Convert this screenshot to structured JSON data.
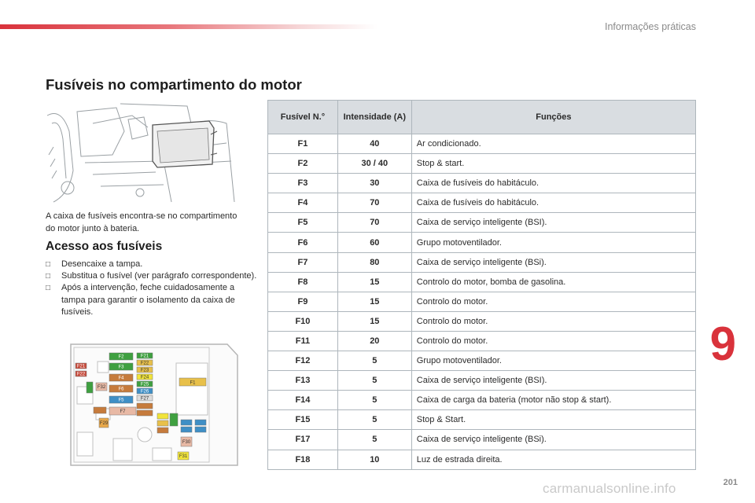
{
  "header": {
    "section_title": "Informações práticas"
  },
  "title": "Fusíveis no compartimento do motor",
  "intro": "A caixa de fusíveis encontra-se no compartimento do motor junto à bateria.",
  "access": {
    "heading": "Acesso aos fusíveis",
    "steps": [
      "Desencaixe a tampa.",
      "Substitua o fusível (ver parágrafo correspondente).",
      "Após a intervenção, feche cuidadosamente a tampa para garantir o isolamento da caixa de fusíveis."
    ]
  },
  "table": {
    "headers": {
      "fuse_no": "Fusível N.°",
      "rating": "Intensidade (A)",
      "functions": "Funções"
    },
    "rows": [
      {
        "fuse": "F1",
        "amps": "40",
        "function": "Ar condicionado."
      },
      {
        "fuse": "F2",
        "amps": "30 / 40",
        "function": "Stop & start."
      },
      {
        "fuse": "F3",
        "amps": "30",
        "function": "Caixa de fusíveis do habitáculo."
      },
      {
        "fuse": "F4",
        "amps": "70",
        "function": "Caixa de fusíveis do habitáculo."
      },
      {
        "fuse": "F5",
        "amps": "70",
        "function": "Caixa de serviço inteligente (BSI)."
      },
      {
        "fuse": "F6",
        "amps": "60",
        "function": "Grupo motoventilador."
      },
      {
        "fuse": "F7",
        "amps": "80",
        "function": "Caixa de serviço inteligente (BSi)."
      },
      {
        "fuse": "F8",
        "amps": "15",
        "function": "Controlo do motor, bomba de gasolina."
      },
      {
        "fuse": "F9",
        "amps": "15",
        "function": "Controlo do motor."
      },
      {
        "fuse": "F10",
        "amps": "15",
        "function": "Controlo do motor."
      },
      {
        "fuse": "F11",
        "amps": "20",
        "function": "Controlo do motor."
      },
      {
        "fuse": "F12",
        "amps": "5",
        "function": "Grupo motoventilador."
      },
      {
        "fuse": "F13",
        "amps": "5",
        "function": "Caixa de serviço inteligente (BSI)."
      },
      {
        "fuse": "F14",
        "amps": "5",
        "function": "Caixa de carga da bateria (motor não stop & start)."
      },
      {
        "fuse": "F15",
        "amps": "5",
        "function": "Stop & Start."
      },
      {
        "fuse": "F17",
        "amps": "5",
        "function": "Caixa de serviço inteligente (BSi)."
      },
      {
        "fuse": "F18",
        "amps": "10",
        "function": "Luz de estrada direita."
      }
    ]
  },
  "diagram_labels": {
    "f1": "F1",
    "f2": "F2",
    "f3": "F3",
    "f4": "F4",
    "f5": "F5",
    "f6": "F6",
    "f7": "F7",
    "f21": "F21",
    "f22": "F22",
    "f23": "F23",
    "f24": "F24",
    "f25": "F25",
    "f26": "F26",
    "f27": "F27",
    "f32": "F32",
    "f29": "F29",
    "f30": "F30",
    "f31": "F31"
  },
  "chapter_number": "9",
  "page_number": "201",
  "watermark": "carmanualsonline.info",
  "colors": {
    "accent": "#d9323b",
    "table_header": "#d9dde1",
    "table_border": "#aeb6bc"
  }
}
